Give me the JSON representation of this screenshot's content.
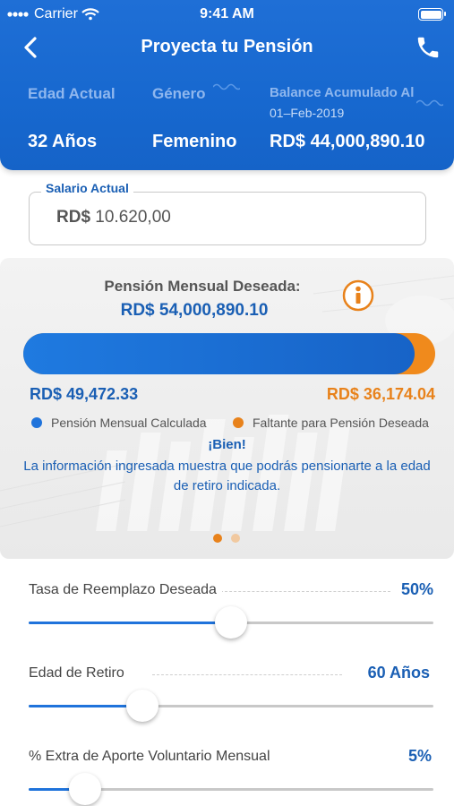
{
  "status_bar": {
    "carrier": "Carrier",
    "time": "9:41 AM"
  },
  "nav": {
    "title": "Proyecta tu Pensión",
    "back_icon": "chevron-left-icon",
    "call_icon": "phone-icon"
  },
  "profile": {
    "age_label": "Edad Actual",
    "age_value": "32 Años",
    "gender_label": "Género",
    "gender_value": "Femenino",
    "balance_label": "Balance Acumulado Al",
    "balance_date": "01–Feb-2019",
    "balance_value": "RD$ 44,000,890.10"
  },
  "salary": {
    "label": "Salario Actual",
    "currency": "RD$",
    "value": "10.620,00"
  },
  "projection": {
    "desired_label": "Pensión Mensual Deseada:",
    "desired_value": "RD$ 54,000,890.10",
    "calculated_value": "RD$ 49,472.33",
    "missing_value": "RD$ 36,174.04",
    "calculated_fraction": 0.95,
    "legend_calculated": "Pensión Mensual Calculada",
    "legend_missing": "Faltante para Pensión Deseada",
    "message_title": "¡Bien!",
    "message_body": "La información ingresada muestra que podrás pensionarte a la edad de retiro indicada.",
    "page_index": 0,
    "page_count": 2
  },
  "sliders": [
    {
      "label": "Tasa de Reemplazo Deseada",
      "value": "50%",
      "level": 0.5
    },
    {
      "label": "Edad de Retiro",
      "value": "60 Años",
      "level": 0.28
    },
    {
      "label": "% Extra de Aporte Voluntario Mensual",
      "value": "5%",
      "level": 0.14
    }
  ],
  "colors": {
    "primary": "#1767cf",
    "accent": "#f08a1c",
    "text_blue": "#1a5fb4"
  }
}
